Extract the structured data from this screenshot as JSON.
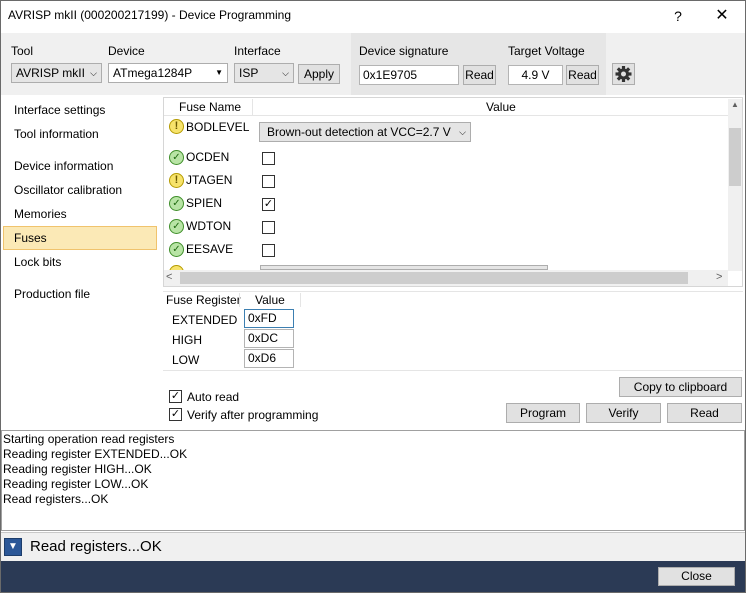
{
  "window": {
    "title": "AVRISP mkII (000200217199) - Device Programming",
    "help_label": "?",
    "close_label": "✕"
  },
  "toolbar": {
    "tool_label": "Tool",
    "tool_value": "AVRISP mkII",
    "device_label": "Device",
    "device_value": "ATmega1284P",
    "interface_label": "Interface",
    "interface_value": "ISP",
    "apply_label": "Apply",
    "signature_label": "Device signature",
    "signature_value": "0x1E9705",
    "signature_read_label": "Read",
    "voltage_label": "Target Voltage",
    "voltage_value": "4.9 V",
    "voltage_read_label": "Read",
    "gear_icon": "gear-icon"
  },
  "nav": {
    "items": [
      {
        "label": "Interface settings"
      },
      {
        "label": "Tool information"
      },
      {
        "label": "Device information"
      },
      {
        "label": "Oscillator calibration"
      },
      {
        "label": "Memories"
      },
      {
        "label": "Fuses"
      },
      {
        "label": "Lock bits"
      },
      {
        "label": "Production file"
      }
    ],
    "selected": "Fuses",
    "selected_color": "#fbe9b6"
  },
  "fuse_grid": {
    "col_name": "Fuse Name",
    "col_value": "Value",
    "rows": [
      {
        "name": "BODLEVEL",
        "icon": "warning-icon",
        "value": "Brown-out detection at VCC=2.7 V"
      },
      {
        "name": "OCDEN",
        "icon": "check-icon",
        "checked": false
      },
      {
        "name": "JTAGEN",
        "icon": "warning-icon",
        "checked": false
      },
      {
        "name": "SPIEN",
        "icon": "check-icon",
        "checked": true
      },
      {
        "name": "WDTON",
        "icon": "check-icon",
        "checked": false
      },
      {
        "name": "EESAVE",
        "icon": "check-icon",
        "checked": false
      },
      {
        "name": "BOOTSZ",
        "icon": "warning-icon"
      }
    ]
  },
  "registers": {
    "col_register": "Fuse Register",
    "col_value": "Value",
    "rows": [
      {
        "name": "EXTENDED",
        "value": "0xFD"
      },
      {
        "name": "HIGH",
        "value": "0xDC"
      },
      {
        "name": "LOW",
        "value": "0xD6"
      }
    ]
  },
  "options": {
    "auto_read_label": "Auto read",
    "auto_read_checked": true,
    "verify_label": "Verify after programming",
    "verify_checked": true,
    "copy_label": "Copy to clipboard",
    "program_label": "Program",
    "verify_button_label": "Verify",
    "read_label": "Read"
  },
  "log": {
    "lines": [
      "Starting operation read registers",
      "Reading register EXTENDED...OK",
      "Reading register HIGH...OK",
      "Reading register LOW...OK",
      "Read registers...OK"
    ]
  },
  "status": {
    "text": "Read registers...OK",
    "toggle_icon": "chevron-down-icon"
  },
  "footer": {
    "close_label": "Close",
    "bar_color": "#2b3a55"
  }
}
